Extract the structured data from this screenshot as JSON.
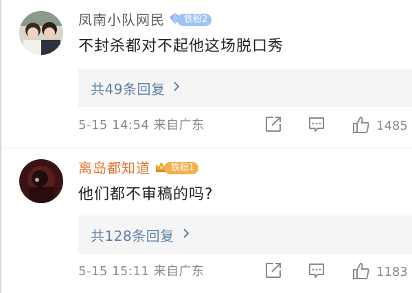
{
  "comments": [
    {
      "username": "凤南小队网民",
      "badge": "铁粉2",
      "text": "不封杀都对不起他这场脱口秀",
      "replies_label": "共49条回复",
      "meta": "5-15 14:54 来自广东",
      "likes": "1485"
    },
    {
      "username": "离岛都知道",
      "badge": "铁粉1",
      "text": "他们都不审稿的吗?",
      "replies_label": "共128条回复",
      "meta": "5-15 15:11 来自广东",
      "likes": "1183"
    }
  ],
  "colors": {
    "username_gray": "#5a5a5a",
    "username_orange": "#e8732a",
    "link_blue": "#5b7ea6",
    "meta_gray": "#8a8a8a",
    "reply_bg": "#f5f5f5"
  },
  "icons": {
    "badge1": "diamond-icon",
    "badge2": "crown-icon",
    "reply_arrow": "chevron-right-icon",
    "share": "share-icon",
    "comment": "comment-icon",
    "like": "thumbs-up-icon"
  }
}
